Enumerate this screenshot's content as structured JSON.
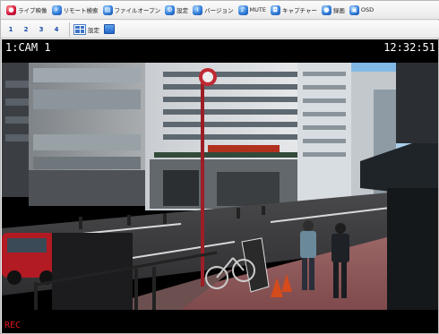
{
  "toolbar": {
    "buttons": [
      {
        "label": "ライブ映像",
        "icon": "live-video-icon",
        "color": "red"
      },
      {
        "label": "リモート検索",
        "icon": "remote-search-icon",
        "color": "blue"
      },
      {
        "label": "ファイルオープン",
        "icon": "file-open-icon",
        "color": "blue"
      },
      {
        "label": "設定",
        "icon": "settings-icon",
        "color": "blue"
      },
      {
        "label": "バージョン",
        "icon": "version-icon",
        "color": "blue"
      },
      {
        "label": "MUTE",
        "icon": "mute-icon",
        "color": "blue"
      },
      {
        "label": "キャプチャー",
        "icon": "capture-icon",
        "color": "blue"
      },
      {
        "label": "録画",
        "icon": "record-icon",
        "color": "blue"
      },
      {
        "label": "OSD",
        "icon": "osd-icon",
        "color": "blue"
      }
    ]
  },
  "camera_bar": {
    "tabs": [
      "1",
      "2",
      "3",
      "4"
    ],
    "settings_label": "設定"
  },
  "viewer": {
    "camera_name": "1:CAM 1",
    "time": "12:32:51",
    "rec_label": "REC"
  },
  "colors": {
    "accent_blue": "#2f7ad8",
    "live_red": "#d4143a",
    "rec_red": "#e0141e"
  }
}
